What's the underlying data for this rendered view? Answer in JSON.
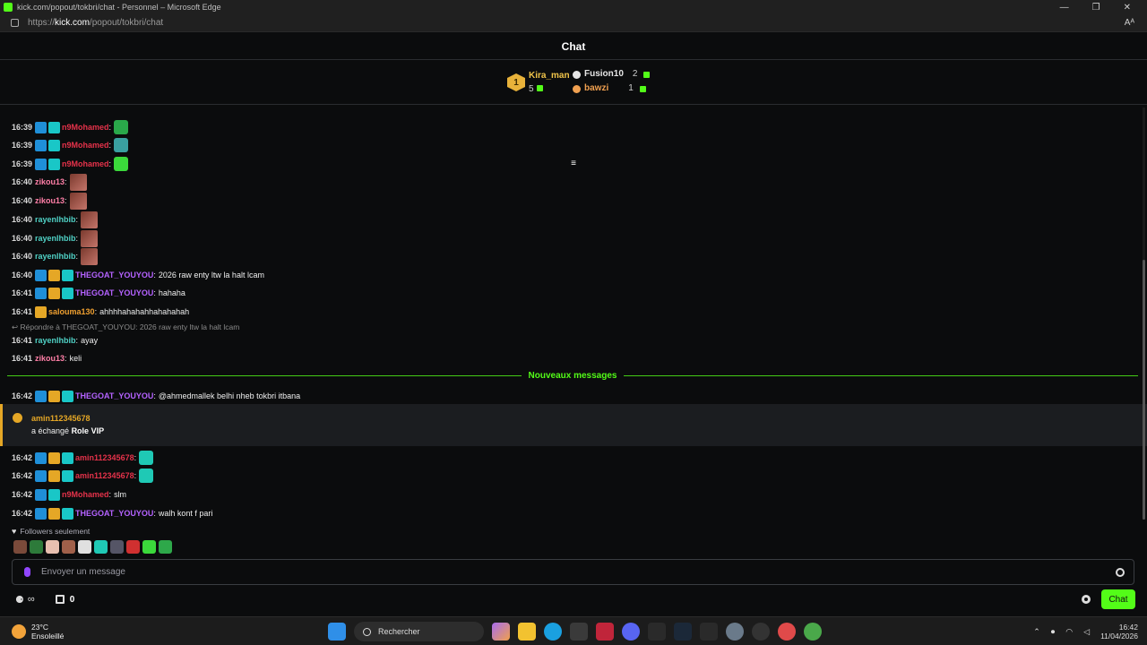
{
  "window": {
    "title": "kick.com/popout/tokbri/chat - Personnel – Microsoft Edge",
    "url_prefix": "https://",
    "url_host": "kick.com",
    "url_path": "/popout/tokbri/chat",
    "read_aloud": "Aᴬ"
  },
  "header": {
    "title": "Chat"
  },
  "leaderboard": {
    "first": {
      "rank": "1",
      "name": "Kira_man",
      "count": "5"
    },
    "others": [
      {
        "name": "Fusion10",
        "count": "2",
        "color": "#e6e6e6"
      },
      {
        "name": "bawzi",
        "count": "1",
        "color": "#f0a050"
      }
    ],
    "scroll_icon": "≡"
  },
  "messages": [
    {
      "time": "16:39",
      "badges": [
        "sub",
        "vip"
      ],
      "user": "n9Mohamed",
      "color": "#e5324a",
      "text": "",
      "emote": "#2aa84a"
    },
    {
      "time": "16:39",
      "badges": [
        "sub",
        "vip"
      ],
      "user": "n9Mohamed",
      "color": "#e5324a",
      "text": "",
      "emote": "#3aa0a0"
    },
    {
      "time": "16:39",
      "badges": [
        "sub",
        "vip"
      ],
      "user": "n9Mohamed",
      "color": "#e5324a",
      "text": "",
      "emote": "#3bd93b"
    },
    {
      "time": "16:40",
      "badges": [],
      "user": "zikou13",
      "color": "#ff7fa7",
      "text": "",
      "emote": "large"
    },
    {
      "time": "16:40",
      "badges": [],
      "user": "zikou13",
      "color": "#ff7fa7",
      "text": "",
      "emote": "large"
    },
    {
      "time": "16:40",
      "badges": [],
      "user": "rayenlhbib",
      "color": "#4fd1c5",
      "text": "",
      "emote": "large"
    },
    {
      "time": "16:40",
      "badges": [],
      "user": "rayenlhbib",
      "color": "#4fd1c5",
      "text": "",
      "emote": "large"
    },
    {
      "time": "16:40",
      "badges": [],
      "user": "rayenlhbib",
      "color": "#4fd1c5",
      "text": "",
      "emote": "large"
    },
    {
      "time": "16:40",
      "badges": [
        "sub",
        "crown",
        "vip"
      ],
      "user": "THEGOAT_YOUYOU",
      "color": "#b462ff",
      "text": "2026 raw enty ltw la halt lcam"
    },
    {
      "time": "16:41",
      "badges": [
        "sub",
        "crown",
        "vip"
      ],
      "user": "THEGOAT_YOUYOU",
      "color": "#b462ff",
      "text": "hahaha"
    },
    {
      "time": "16:41",
      "badges": [
        "crown"
      ],
      "user": "salouma130",
      "color": "#f0a030",
      "text": "ahhhhahahahhahahahah"
    },
    {
      "time": "16:41",
      "badges": [],
      "user": "rayenlhbib",
      "color": "#4fd1c5",
      "text": "ayay"
    },
    {
      "time": "16:41",
      "badges": [],
      "user": "zikou13",
      "color": "#ff7fa7",
      "text": "keli"
    },
    {
      "time": "16:42",
      "badges": [
        "sub",
        "crown",
        "vip"
      ],
      "user": "THEGOAT_YOUYOU",
      "color": "#b462ff",
      "text": "@ahmedmallek belhi nheb tokbri itbana"
    },
    {
      "time": "16:42",
      "badges": [
        "sub",
        "crown",
        "vip"
      ],
      "user": "amin112345678",
      "color": "#e5324a",
      "text": "",
      "emote": "#1fc9b5"
    },
    {
      "time": "16:42",
      "badges": [
        "sub",
        "crown",
        "vip"
      ],
      "user": "amin112345678",
      "color": "#e5324a",
      "text": "",
      "emote": "#1fc9b5"
    },
    {
      "time": "16:42",
      "badges": [
        "sub",
        "vip"
      ],
      "user": "n9Mohamed",
      "color": "#e5324a",
      "text": "slm"
    },
    {
      "time": "16:42",
      "badges": [
        "sub",
        "crown",
        "vip"
      ],
      "user": "THEGOAT_YOUYOU",
      "color": "#b462ff",
      "text": "walh kont f pari"
    }
  ],
  "reply_note": "Répondre à THEGOAT_YOUYOU: 2026 raw enty ltw la halt lcam",
  "divider_label": "Nouveaux messages",
  "system": {
    "user": "amin112345678",
    "prefix": "a échangé",
    "reward": "Role VIP"
  },
  "followers_label": "Followers seulement",
  "emote_bar": [
    "#7a4a3a",
    "#2d7a3a",
    "#e8c0b0",
    "#a0604a",
    "#e0e0e0",
    "#1fc9b5",
    "#555566",
    "#d03030",
    "#3bd93b",
    "#2ea84a"
  ],
  "input": {
    "placeholder": "Envoyer un message"
  },
  "footer": {
    "points": "∞",
    "store_count": "0",
    "chat_label": "Chat"
  },
  "taskbar": {
    "temp": "23°C",
    "weather": "Ensoleillé",
    "search": "Rechercher",
    "time": "16:42",
    "date": "11/04/2026"
  }
}
